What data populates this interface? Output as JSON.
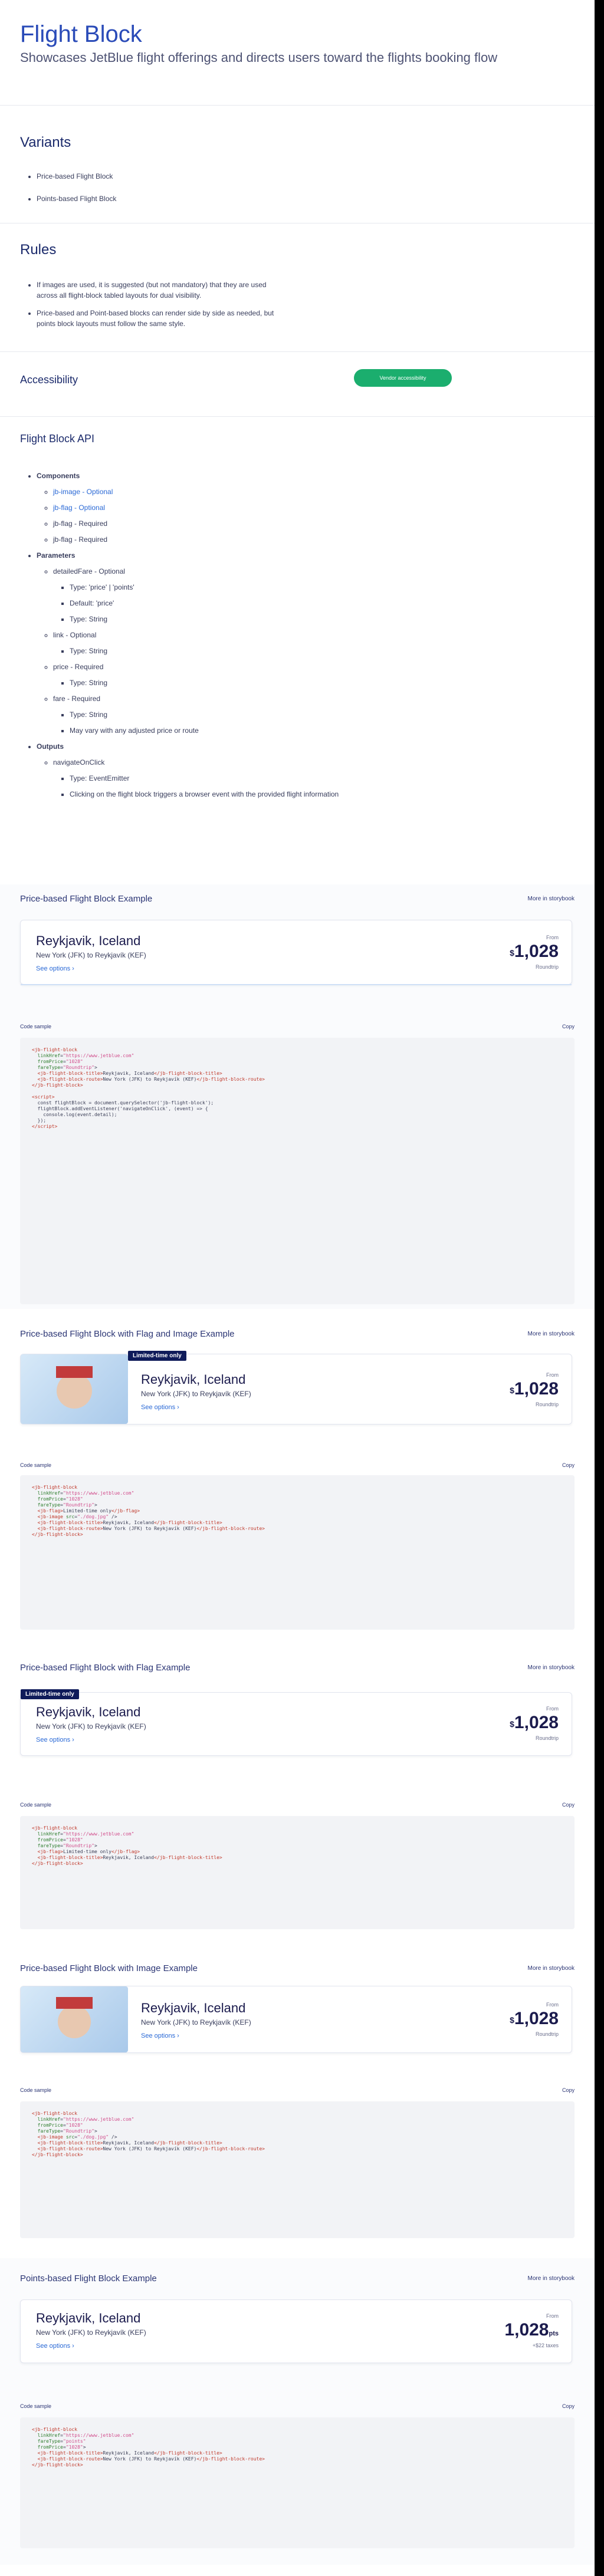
{
  "header": {
    "title": "Flight Block",
    "lead": "Showcases JetBlue flight offerings and directs users toward the flights booking flow"
  },
  "variants": {
    "title": "Variants",
    "items": [
      "Price-based Flight Block",
      "Points-based Flight Block"
    ]
  },
  "rules": {
    "title": "Rules",
    "items": [
      "If images are used, it is suggested (but not mandatory) that they are used across all flight-block tabled layouts for dual visibility.",
      "Price-based and Point-based blocks can render side by side as needed, but points block layouts must follow the same style."
    ]
  },
  "accessibility": {
    "title": "Accessibility",
    "button": "Vendor accessibility"
  },
  "api": {
    "title": "Flight Block API",
    "components_label": "Components",
    "components": [
      "jb-image - Optional",
      "jb-flag - Optional",
      "jb-flag - Required",
      "jb-flag - Required"
    ],
    "parameters_label": "Parameters",
    "params": [
      {
        "name": "detailedFare - Optional",
        "sub": [
          "Type: 'price' | 'points'",
          "Default: 'price'",
          "Type: String"
        ]
      },
      {
        "name": "link - Optional",
        "sub": [
          "Type: String"
        ]
      },
      {
        "name": "price - Required",
        "sub": [
          "Type: String"
        ]
      },
      {
        "name": "fare - Required",
        "sub": [
          "Type: String",
          "May vary with any adjusted price or route"
        ]
      }
    ],
    "outputs_label": "Outputs",
    "outputs": [
      {
        "name": "navigateOnClick",
        "sub": [
          "Type: EventEmitter",
          "Clicking on the flight block triggers a browser event with the provided flight information"
        ]
      }
    ]
  },
  "flight": {
    "city": "Reykjavik, Iceland",
    "route": "New York (JFK) to Reykjavík (KEF)",
    "see_options": "See options ›",
    "from": "From",
    "price": "1,028",
    "currency": "$",
    "ppp": "Roundtrip",
    "points": "1,028",
    "points_unit": "pts",
    "points_sub": "+$22 taxes"
  },
  "flag_text": "Limited-time only",
  "code_label": "Code sample",
  "code_copy": "Copy",
  "examples": [
    {
      "title": "Price-based Flight Block Example",
      "more": "More in storybook"
    },
    {
      "title": "Price-based Flight Block with Flag and Image Example",
      "more": "More in storybook"
    },
    {
      "title": "Price-based Flight Block with Flag Example",
      "more": "More in storybook"
    },
    {
      "title": "Price-based Flight Block with Image Example",
      "more": "More in storybook"
    },
    {
      "title": "Points-based Flight Block Example",
      "more": "More in storybook"
    }
  ],
  "colors": {
    "accent": "#2a4bb8",
    "green": "#1bae6e",
    "navy": "#0f1b5a"
  }
}
